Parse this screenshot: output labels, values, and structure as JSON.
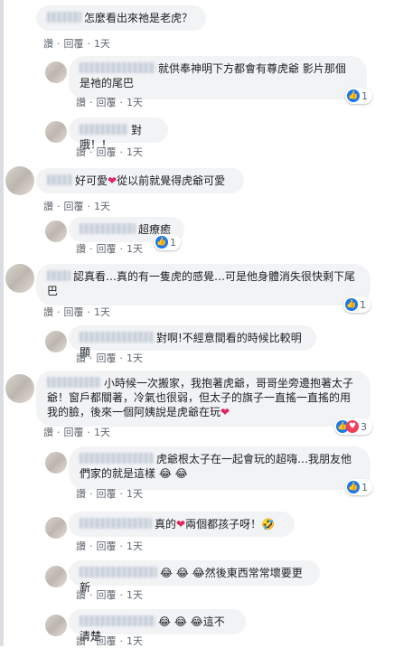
{
  "actions": {
    "like": "讚",
    "reply": "回覆",
    "time": "1天",
    "sep": "·"
  },
  "comments": [
    {
      "text": "怎麼看出來祂是老虎？"
    },
    {
      "text": "就供奉神明下方都會有尊虎爺 影片那個是祂的尾巴",
      "reaction_count": "1"
    },
    {
      "text": "對哦！！"
    },
    {
      "text_a": "好可愛",
      "heart": "❤",
      "text_b": "從以前就覺得虎爺可愛"
    },
    {
      "text": "超療癒",
      "reaction_count": "1"
    },
    {
      "text": "認真看…真的有一隻虎的感覺…可是他身體消失很快剩下尾巴",
      "reaction_count": "1"
    },
    {
      "text": "對啊!不經意間看的時候比較明顯"
    },
    {
      "text": "小時候一次搬家，我抱著虎爺，哥哥坐旁邊抱著太子爺！窗戶都關著，冷氣也很弱，但太子的旗子一直搖一直搖的用我的臉，後來一個阿姨說是虎爺在玩",
      "heart": "❤",
      "reaction_count": "3"
    },
    {
      "text": "虎爺根太子在一起會玩的超嗨…我朋友他們家的就是這樣",
      "emoji": "😂 😂",
      "reaction_count": "1"
    },
    {
      "text_a": "真的",
      "heart": "❤",
      "text_b": "兩個都孩子呀！",
      "emoji": "🤣"
    },
    {
      "emoji": "😂 😂 😂",
      "text": "然後東西常常壞要更新"
    },
    {
      "emoji": "😂 😂 😂",
      "text": "這不清楚"
    }
  ],
  "colors": {
    "like": "#1877f2",
    "love": "#f33e58",
    "haha": "#f7b125",
    "bubble": "#f2f3f5",
    "meta": "#606770"
  },
  "icons": {
    "like": "thumbs-up-icon",
    "love": "love-icon",
    "haha": "haha-icon"
  }
}
